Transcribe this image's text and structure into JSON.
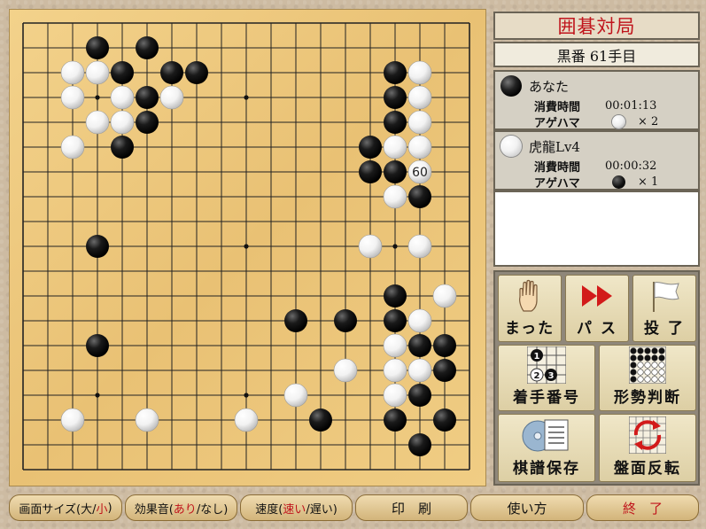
{
  "app": {
    "title": "囲碁対局",
    "turn": "黒番 61手目"
  },
  "players": [
    {
      "color": "black",
      "name": "あなた",
      "time_label": "消費時間",
      "time": "00:01:13",
      "captures_label": "アゲハマ",
      "captured_stone": "white",
      "captures": "× 2"
    },
    {
      "color": "white",
      "name": "虎龍Lv4",
      "time_label": "消費時間",
      "time": "00:00:32",
      "captures_label": "アゲハマ",
      "captured_stone": "black",
      "captures": "× 1"
    }
  ],
  "message": "",
  "buttons": {
    "undo": {
      "label": "まった",
      "icon": "hand-icon"
    },
    "pass": {
      "label": "パ ス",
      "icon": "fast-forward-icon"
    },
    "resign": {
      "label": "投 了",
      "icon": "white-flag-icon"
    },
    "move_numbers": {
      "label": "着手番号",
      "icon": "move-number-icon"
    },
    "evaluate": {
      "label": "形勢判断",
      "icon": "territory-grid-icon"
    },
    "save_record": {
      "label": "棋譜保存",
      "icon": "disk-document-icon"
    },
    "flip_board": {
      "label": "盤面反転",
      "icon": "rotate-board-icon"
    }
  },
  "bottom": {
    "screen_size": {
      "prefix": "画面サイズ(大/",
      "active": "小",
      "suffix": ")"
    },
    "sound": {
      "prefix": "効果音(",
      "active": "あり",
      "suffix": "/なし)"
    },
    "speed": {
      "prefix": "速度(",
      "active": "速い",
      "suffix": "/遅い)"
    },
    "print": "印　刷",
    "help": "使い方",
    "quit": "終　了"
  },
  "board": {
    "size": 19,
    "last_move_label": "60",
    "last_move": [
      16,
      6
    ],
    "black": [
      [
        3,
        1
      ],
      [
        5,
        1
      ],
      [
        4,
        2
      ],
      [
        6,
        2
      ],
      [
        7,
        2
      ],
      [
        5,
        3
      ],
      [
        5,
        4
      ],
      [
        4,
        5
      ],
      [
        15,
        2
      ],
      [
        15,
        3
      ],
      [
        15,
        4
      ],
      [
        14,
        5
      ],
      [
        14,
        6
      ],
      [
        15,
        6
      ],
      [
        16,
        7
      ],
      [
        3,
        9
      ],
      [
        15,
        11
      ],
      [
        11,
        12
      ],
      [
        13,
        12
      ],
      [
        15,
        12
      ],
      [
        16,
        13
      ],
      [
        17,
        13
      ],
      [
        3,
        13
      ],
      [
        17,
        14
      ],
      [
        16,
        15
      ],
      [
        12,
        16
      ],
      [
        15,
        16
      ],
      [
        17,
        16
      ],
      [
        16,
        17
      ]
    ],
    "white": [
      [
        2,
        2
      ],
      [
        3,
        2
      ],
      [
        2,
        3
      ],
      [
        4,
        3
      ],
      [
        6,
        3
      ],
      [
        16,
        2
      ],
      [
        16,
        3
      ],
      [
        3,
        4
      ],
      [
        4,
        4
      ],
      [
        16,
        4
      ],
      [
        2,
        5
      ],
      [
        15,
        5
      ],
      [
        16,
        5
      ],
      [
        15,
        7
      ],
      [
        14,
        9
      ],
      [
        16,
        9
      ],
      [
        17,
        11
      ],
      [
        16,
        12
      ],
      [
        15,
        13
      ],
      [
        13,
        14
      ],
      [
        15,
        14
      ],
      [
        16,
        14
      ],
      [
        11,
        15
      ],
      [
        15,
        15
      ],
      [
        2,
        16
      ],
      [
        5,
        16
      ],
      [
        9,
        16
      ]
    ],
    "hoshi": [
      [
        3,
        3
      ],
      [
        9,
        3
      ],
      [
        15,
        3
      ],
      [
        3,
        9
      ],
      [
        9,
        9
      ],
      [
        15,
        9
      ],
      [
        3,
        15
      ],
      [
        9,
        15
      ],
      [
        15,
        15
      ]
    ]
  }
}
